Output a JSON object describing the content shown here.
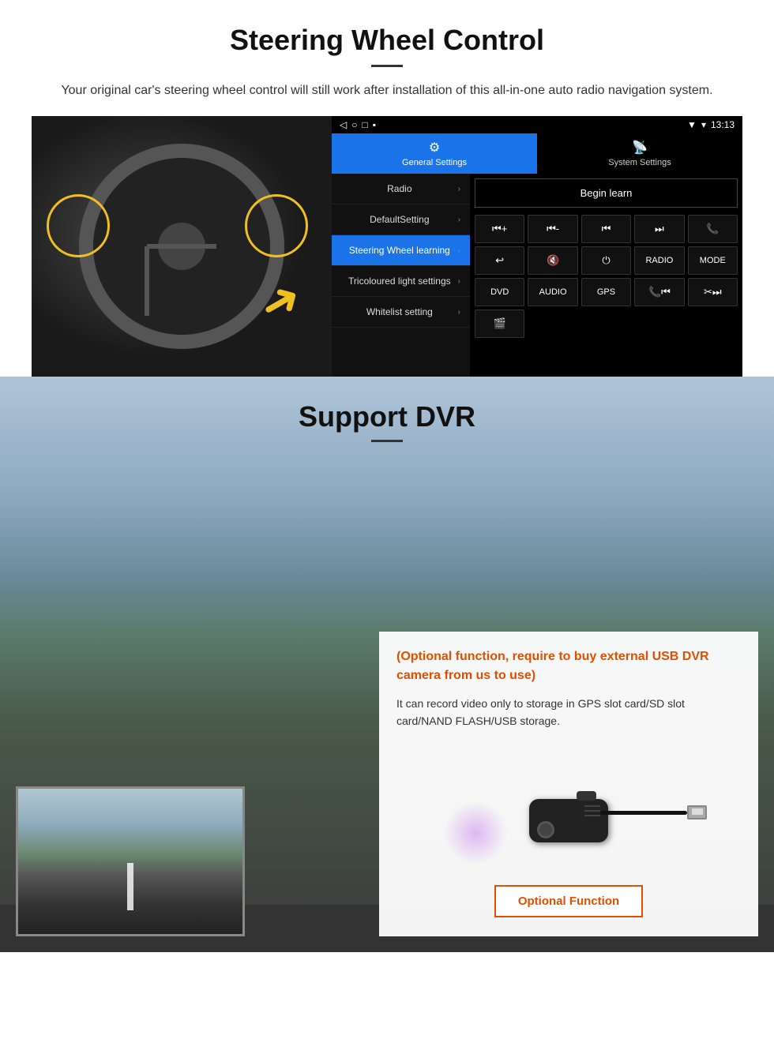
{
  "steering": {
    "title": "Steering Wheel Control",
    "subtitle": "Your original car's steering wheel control will still work after installation of this all-in-one auto radio navigation system.",
    "statusbar": {
      "time": "13:13",
      "signal": "▼",
      "wifi": "▾"
    },
    "tabs": [
      {
        "label": "General Settings",
        "icon": "⚙",
        "active": true
      },
      {
        "label": "System Settings",
        "icon": "📡",
        "active": false
      }
    ],
    "menu_items": [
      {
        "label": "Radio",
        "active": false
      },
      {
        "label": "DefaultSetting",
        "active": false
      },
      {
        "label": "Steering Wheel learning",
        "active": true
      },
      {
        "label": "Tricoloured light settings",
        "active": false
      },
      {
        "label": "Whitelist setting",
        "active": false
      }
    ],
    "begin_learn_label": "Begin learn",
    "ctrl_buttons": [
      "⏮+",
      "⏮-",
      "⏮",
      "⏭",
      "📞",
      "↩",
      "🔇×",
      "⏻",
      "RADIO",
      "MODE",
      "DVD",
      "AUDIO",
      "GPS",
      "📞⏮",
      "✂⏭",
      "🎬"
    ]
  },
  "dvr": {
    "title": "Support DVR",
    "optional_text": "(Optional function, require to buy external USB DVR camera from us to use)",
    "description": "It can record video only to storage in GPS slot card/SD slot card/NAND FLASH/USB storage.",
    "optional_function_label": "Optional Function",
    "camera_alt": "USB DVR Camera"
  }
}
